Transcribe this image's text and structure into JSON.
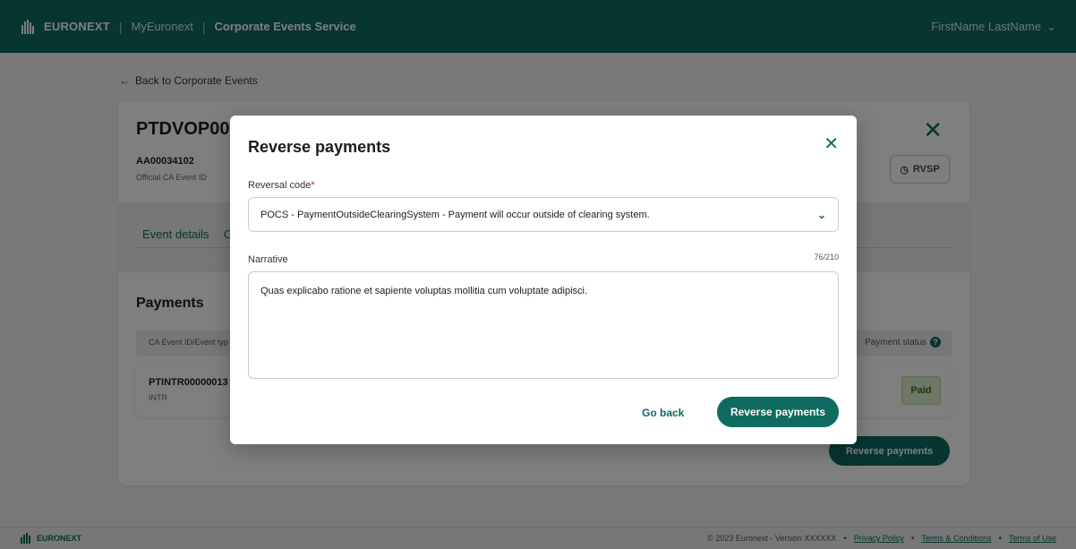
{
  "header": {
    "brand": "EURONEXT",
    "my_link": "MyEuronext",
    "service": "Corporate Events Service",
    "user": "FirstName LastName"
  },
  "back_link": "Back to Corporate Events",
  "event": {
    "title": "PTDVOP000",
    "official_id": "AA00034102",
    "official_id_label": "Official CA Event ID",
    "rvsp_label": "RVSP"
  },
  "tabs": {
    "event_details": "Event details",
    "second_fragment": "O"
  },
  "payments": {
    "title": "Payments",
    "col_left": "CA Event ID/Event typ",
    "col_status": "Payment status",
    "row": {
      "id": "PTINTR00000013",
      "type": "INTR",
      "status": "Paid"
    },
    "reverse_button": "Reverse payments"
  },
  "modal": {
    "title": "Reverse payments",
    "reversal_code_label": "Reversal code",
    "required_mark": "*",
    "reversal_code_value": "POCS - PaymentOutsideClearingSystem - Payment will occur outside of clearing system.",
    "narrative_label": "Narrative",
    "narrative_counter": "76/210",
    "narrative_value": "Quas explicabo ratione et sapiente voluptas mollitia cum voluptate adipisci.",
    "go_back": "Go back",
    "confirm": "Reverse payments"
  },
  "footer": {
    "brand": "EURONEXT",
    "copyright": "© 2023 Euronext - Version XXXXXX",
    "privacy": "Privacy Policy",
    "terms_conditions": "Terms & Conditions",
    "terms_use": "Terms of Use"
  },
  "colors": {
    "brand_green": "#0f6b60",
    "required_red": "#c62828",
    "paid_bg": "#dcefd0"
  }
}
